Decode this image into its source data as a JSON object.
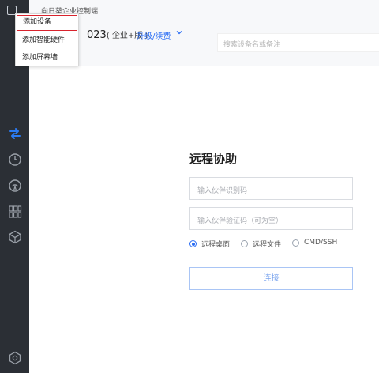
{
  "app": {
    "title": "向日葵企业控制端",
    "version_suffix": "023",
    "edition": "( 企业+版 )",
    "upgrade_label": "升级/续费"
  },
  "search": {
    "placeholder": "搜索设备名或备注"
  },
  "dropdown_menu": {
    "items": [
      "添加设备",
      "添加智能硬件",
      "添加屏幕墙"
    ],
    "highlighted_index": 0
  },
  "remote_assist": {
    "title": "远程协助",
    "partner_id_placeholder": "输入伙伴识别码",
    "verify_code_placeholder": "输入伙伴验证码（可为空）",
    "modes": [
      "远程桌面",
      "远程文件",
      "CMD/SSH"
    ],
    "selected_mode": "远程桌面",
    "connect_label": "连接"
  },
  "sidebar": {
    "icons": [
      "remote-control-icon",
      "history-clock-icon",
      "wireless-icon",
      "apps-grid-icon",
      "cube-icon",
      "settings-hexagon-icon"
    ],
    "active": "remote-control-icon"
  },
  "colors": {
    "accent": "#2a6df4",
    "sidebar": "#2b2f35",
    "highlight_border": "#d9232d"
  }
}
